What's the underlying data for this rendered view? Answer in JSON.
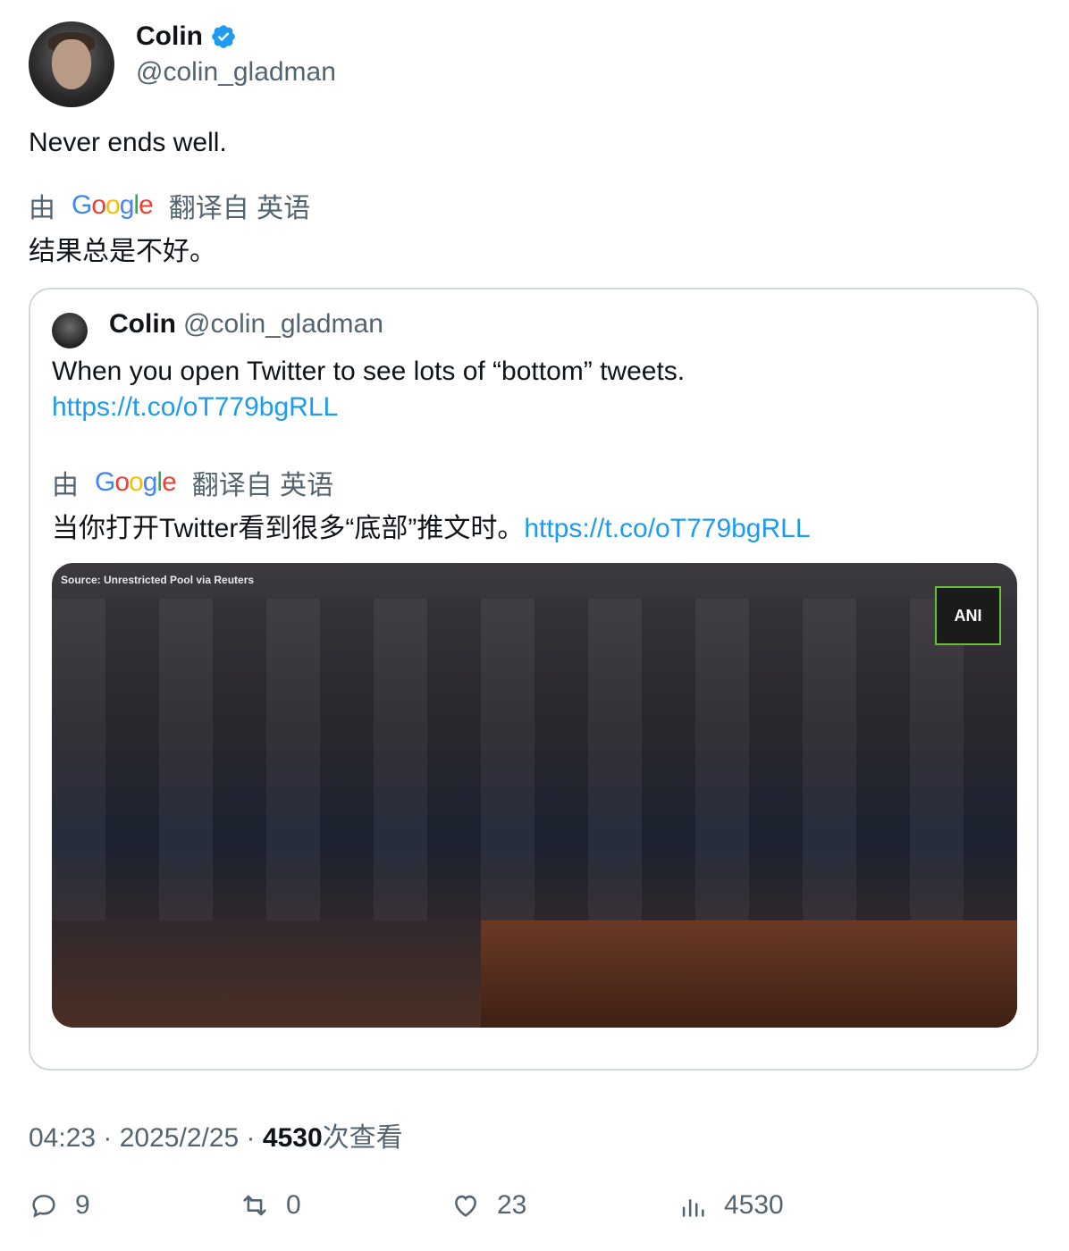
{
  "author": {
    "display_name": "Colin",
    "handle": "@colin_gladman"
  },
  "tweet": {
    "text": "Never ends well.",
    "translation": {
      "prefix": "由",
      "provider": "Google",
      "suffix": "翻译自 英语",
      "text": "结果总是不好。"
    }
  },
  "quote": {
    "display_name": "Colin",
    "handle": "@colin_gladman",
    "text": "When you open Twitter to see lots of “bottom” tweets.",
    "link": "https://t.co/oT779bgRLL",
    "translation": {
      "prefix": "由",
      "provider": "Google",
      "suffix": "翻译自 英语",
      "text": "当你打开Twitter看到很多“底部”推文时。",
      "link": "https://t.co/oT779bgRLL"
    },
    "media": {
      "source_caption": "Source: Unrestricted Pool via Reuters",
      "logo_text": "ANI"
    }
  },
  "meta": {
    "time": "04:23",
    "sep1": " · ",
    "date": "2025/2/25",
    "sep2": " · ",
    "views_count": "4530",
    "views_label": "次查看"
  },
  "actions": {
    "replies": "9",
    "retweets": "0",
    "likes": "23",
    "views": "4530"
  },
  "colors": {
    "accent": "#1d9bf0",
    "secondary_text": "#536471",
    "border": "#cfd9de"
  }
}
